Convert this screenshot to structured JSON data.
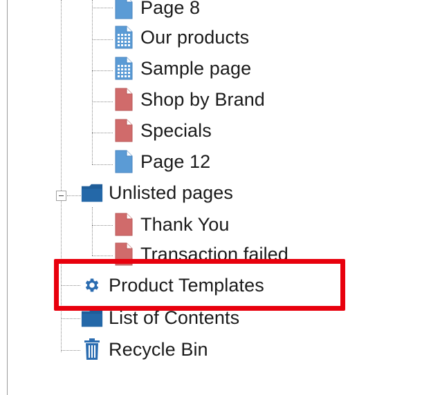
{
  "tree": {
    "children_of_previous": [
      {
        "label": "Page 8",
        "icon": "page-blue-icon"
      },
      {
        "label": "Our products",
        "icon": "page-grid-icon"
      },
      {
        "label": "Sample page",
        "icon": "page-grid-icon"
      },
      {
        "label": "Shop by Brand",
        "icon": "page-red-icon"
      },
      {
        "label": "Specials",
        "icon": "page-red-icon"
      },
      {
        "label": "Page 12",
        "icon": "page-blue-icon"
      }
    ],
    "unlisted": {
      "label": "Unlisted pages",
      "icon": "folder-icon",
      "expanded": true,
      "children": [
        {
          "label": "Thank You",
          "icon": "page-red-icon"
        },
        {
          "label": "Transaction failed",
          "icon": "page-red-icon"
        }
      ]
    },
    "product_templates": {
      "label": "Product Templates",
      "icon": "gear-icon"
    },
    "list_of_contents": {
      "label": "List of Contents",
      "icon": "folder-icon"
    },
    "recycle_bin": {
      "label": "Recycle Bin",
      "icon": "trash-icon"
    }
  },
  "colors": {
    "page_blue": "#5b9bd5",
    "page_red": "#d06b6b",
    "folder": "#1f5d99",
    "gear": "#2b6cb0",
    "highlight": "#e8000d"
  }
}
